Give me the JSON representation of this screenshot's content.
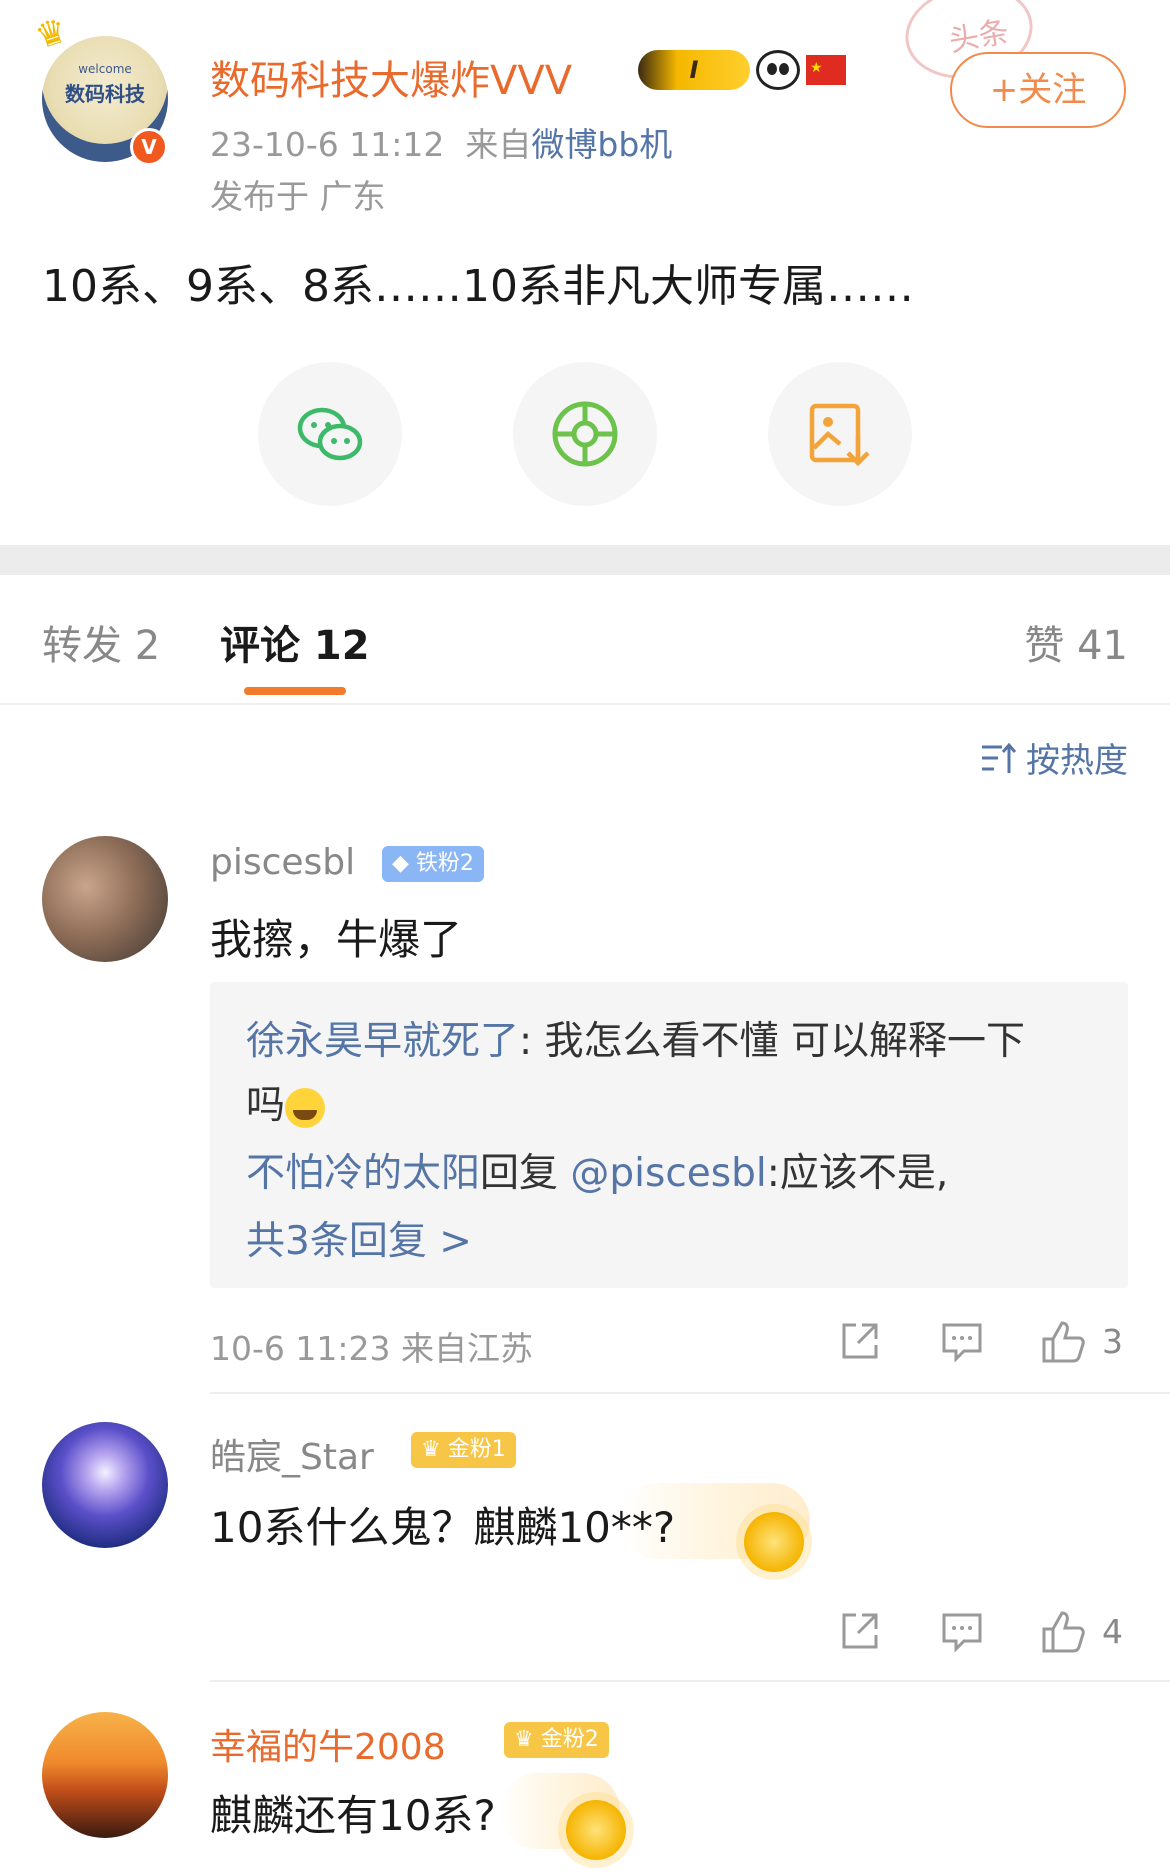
{
  "post": {
    "stamp_text": "头条",
    "avatar_text_small": "welcome",
    "avatar_text_big": "数码科技",
    "verified_mark": "V",
    "author": "数码科技大爆炸VVV",
    "vip_label": "I",
    "follow_label": "+关注",
    "timestamp": "23-10-6 11:12",
    "source_prefix": "来自",
    "source": "微博bb机",
    "location": "发布于 广东",
    "text": "10系、9系、8系……10系非凡大师专属……"
  },
  "share": {
    "icons": [
      "wechat-icon",
      "moments-icon",
      "save-image-icon"
    ],
    "colors": {
      "wechat": "#3cba6a",
      "moments": "#6cc24a",
      "save": "#f2a33a"
    }
  },
  "tabs": {
    "repost": "转发 2",
    "comment": "评论 12",
    "like": "赞 41"
  },
  "sort_label": "按热度",
  "comments": [
    {
      "user": "piscesbl",
      "badge": "铁粉2",
      "text": "我擦，牛爆了",
      "replies": {
        "r1_user": "徐永昊早就死了",
        "r1_text": ": 我怎么看不懂 可以解释一下",
        "r1_text2": "吗",
        "r2_user": "不怕冷的太阳",
        "r2_mid": "回复 ",
        "r2_mention": "@piscesbl",
        "r2_text": ":应该不是,",
        "more": "共3条回复 >"
      },
      "time": "10-6 11:23  来自江苏",
      "likes": "3"
    },
    {
      "user": "皓宸_Star",
      "badge": "金粉1",
      "text": "10系什么鬼？麒麟10**?",
      "likes": "4"
    },
    {
      "user": "幸福的牛2008",
      "badge": "金粉2",
      "text": "麒麟还有10系?"
    }
  ],
  "colors": {
    "accent_orange": "#e86a2c",
    "link_blue": "#5475a6",
    "tab_underline": "#f17b2a"
  }
}
